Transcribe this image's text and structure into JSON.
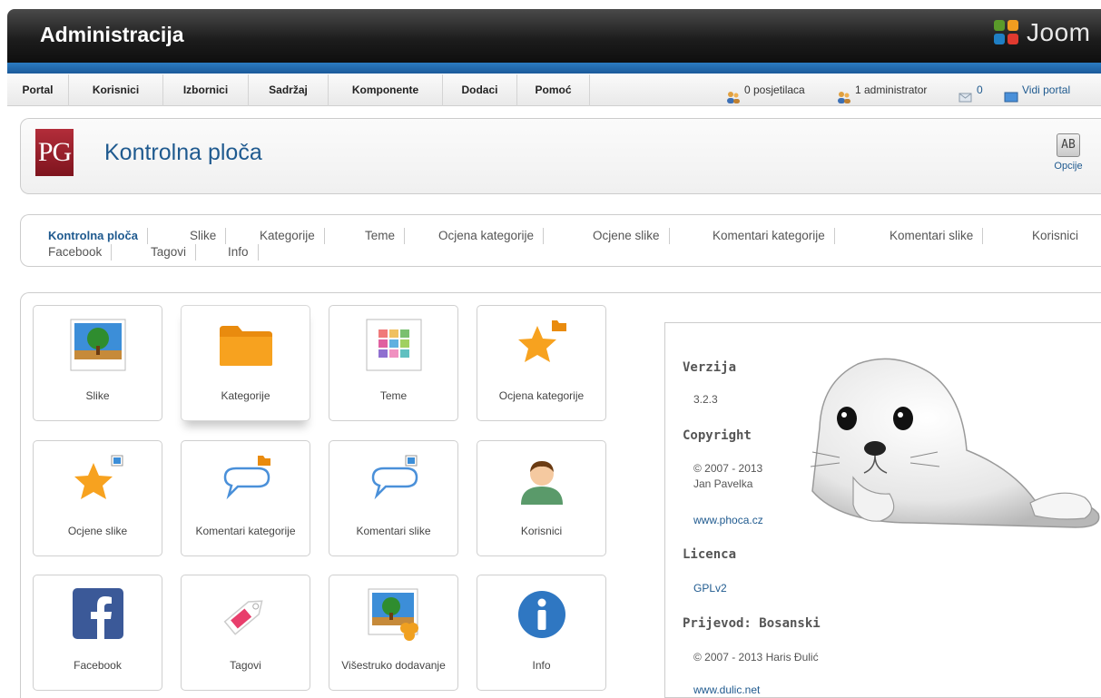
{
  "header": {
    "title": "Administracija",
    "logo_text": "Joom"
  },
  "menu": {
    "items": [
      {
        "label": "Portal"
      },
      {
        "label": "Korisnici"
      },
      {
        "label": "Izbornici"
      },
      {
        "label": "Sadržaj"
      },
      {
        "label": "Komponente"
      },
      {
        "label": "Dodaci"
      },
      {
        "label": "Pomoć"
      }
    ],
    "status": {
      "visitors": "0 posjetilaca",
      "admins": "1 administrator",
      "messages": "0",
      "view_site": "Vidi portal"
    }
  },
  "page": {
    "logo_text": "PG",
    "title": "Kontrolna ploča",
    "options_icon_text": "AB",
    "options_label": "Opcije"
  },
  "tabs": [
    {
      "label": "Kontrolna ploča"
    },
    {
      "label": "Slike"
    },
    {
      "label": "Kategorije"
    },
    {
      "label": "Teme"
    },
    {
      "label": "Ocjena kategorije"
    },
    {
      "label": "Ocjene slike"
    },
    {
      "label": "Komentari kategorije"
    },
    {
      "label": "Komentari slike"
    },
    {
      "label": "Korisnici"
    },
    {
      "label": "Facebook"
    },
    {
      "label": "Tagovi"
    },
    {
      "label": "Info"
    }
  ],
  "tiles": [
    {
      "label": "Slike",
      "icon": "image-icon"
    },
    {
      "label": "Kategorije",
      "icon": "folder-icon"
    },
    {
      "label": "Teme",
      "icon": "themes-icon"
    },
    {
      "label": "Ocjena kategorije",
      "icon": "star-folder-icon"
    },
    {
      "label": "Ocjene slike",
      "icon": "star-image-icon"
    },
    {
      "label": "Komentari kategorije",
      "icon": "comment-folder-icon"
    },
    {
      "label": "Komentari slike",
      "icon": "comment-image-icon"
    },
    {
      "label": "Korisnici",
      "icon": "user-icon"
    },
    {
      "label": "Facebook",
      "icon": "facebook-icon"
    },
    {
      "label": "Tagovi",
      "icon": "tag-icon"
    },
    {
      "label": "Višestruko dodavanje",
      "icon": "multiple-add-icon"
    },
    {
      "label": "Info",
      "icon": "info-icon"
    }
  ],
  "info": {
    "version_heading": "Verzija",
    "version": "3.2.3",
    "copyright_heading": "Copyright",
    "copyright_line1": "© 2007 - 2013",
    "copyright_line2": "Jan Pavelka",
    "website": "www.phoca.cz",
    "license_heading": "Licenca",
    "license": "GPLv2",
    "translation_heading": "Prijevod: Bosanski",
    "translation_copyright": "© 2007 - 2013 Haris Đulić",
    "translation_website": "www.dulic.net"
  },
  "colors": {
    "accent_blue": "#1f5a8f",
    "header_dark": "#1c1c1c",
    "strip_blue": "#2b7bc1",
    "pg_red": "#a32533"
  }
}
